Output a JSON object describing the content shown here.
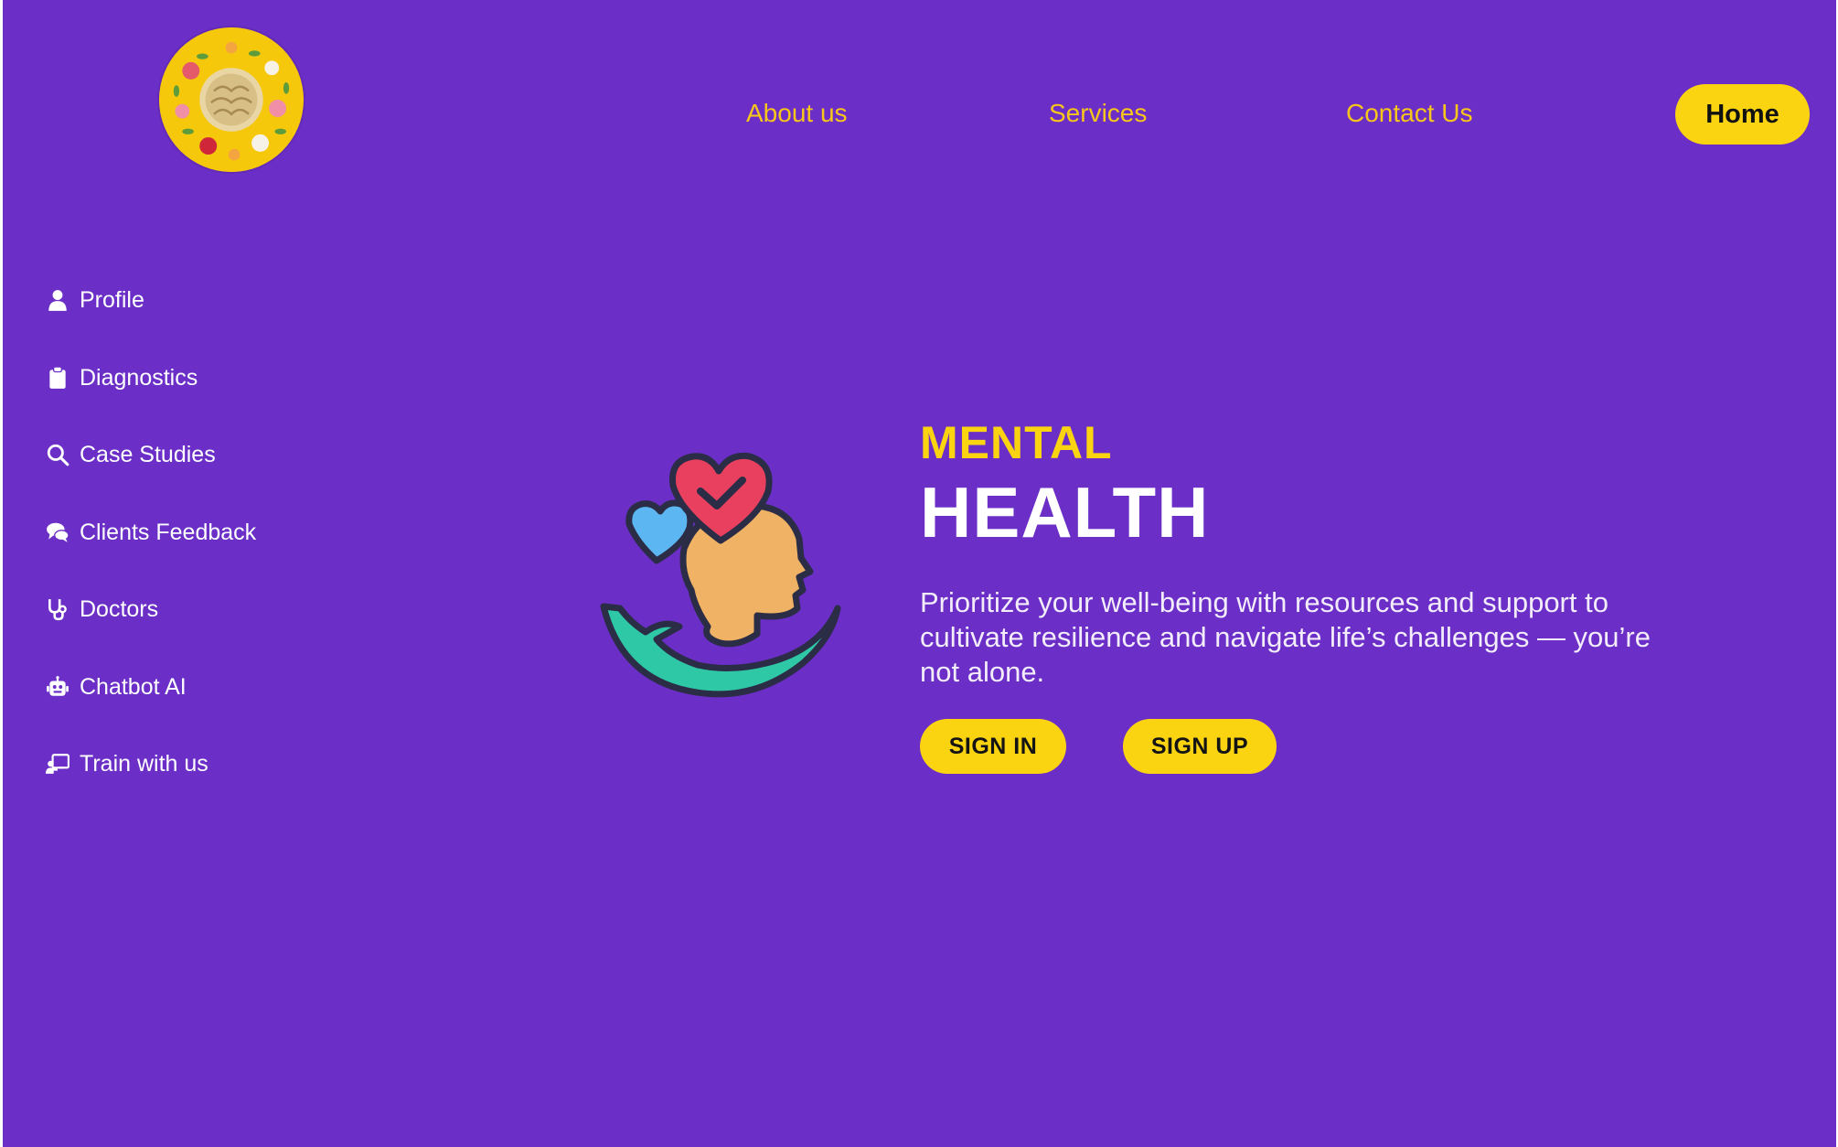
{
  "brand": {
    "logo_icon": "flower-wreath-logo",
    "background_color": "#6b2ec6",
    "accent_color": "#fbd411"
  },
  "nav": {
    "about": "About us",
    "services": "Services",
    "contact": "Contact Us",
    "home": "Home"
  },
  "sidebar": {
    "items": [
      {
        "label": "Profile",
        "icon": "user-icon"
      },
      {
        "label": "Diagnostics",
        "icon": "clipboard-icon"
      },
      {
        "label": "Case Studies",
        "icon": "search-icon"
      },
      {
        "label": "Clients Feedback",
        "icon": "comments-icon"
      },
      {
        "label": "Doctors",
        "icon": "stethoscope-icon"
      },
      {
        "label": "Chatbot AI",
        "icon": "robot-icon"
      },
      {
        "label": "Train with us",
        "icon": "chalkboard-teacher-icon"
      }
    ]
  },
  "hero": {
    "illustration": "mental-health-head-hearts-hand-icon",
    "kicker": "MENTAL",
    "title": "HEALTH",
    "description": "Prioritize your well-being with resources and support to cultivate resilience and navigate life’s challenges — you’re not alone.",
    "sign_in": "SIGN IN",
    "sign_up": "SIGN UP"
  }
}
